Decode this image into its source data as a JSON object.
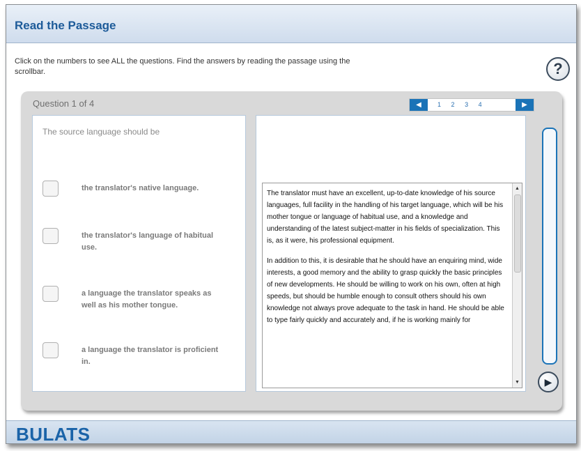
{
  "header": {
    "title": "Read the Passage"
  },
  "instructions": "Click on the numbers to see ALL the questions. Find the answers by reading the passage using the scrollbar.",
  "help": {
    "label": "?"
  },
  "question": {
    "counter": "Question 1 of 4",
    "text": "The source language should be",
    "options": [
      "the translator's native language.",
      "the translator's language of habitual use.",
      "a language the translator speaks as well as his mother tongue.",
      "a language the translator is proficient in."
    ]
  },
  "nav": {
    "prev_icon": "left-arrow-icon",
    "next_icon": "right-arrow-icon",
    "pages": [
      "1",
      "2",
      "3",
      "4"
    ],
    "accent": "#1a73b7"
  },
  "passage": {
    "paragraphs": [
      "The translator must have an excellent, up-to-date knowledge of his source languages, full facility in the handling of his target language, which will be his mother tongue or language of habitual use, and a knowledge and understanding of the latest subject-matter in his fields of specialization. This is, as it were, his professional equipment.",
      "In addition to this, it is desirable that he should have an enquiring mind, wide interests, a good memory and the ability to grasp quickly the basic principles of new developments. He should be willing to work on his own, often at high speeds, but should be humble enough to consult others should his own knowledge not always prove adequate to the task in hand. He should be able to type fairly quickly and accurately and, if he is working mainly for"
    ]
  },
  "next_button": {
    "icon": "play-icon"
  },
  "footer": {
    "brand": "BULATS"
  }
}
